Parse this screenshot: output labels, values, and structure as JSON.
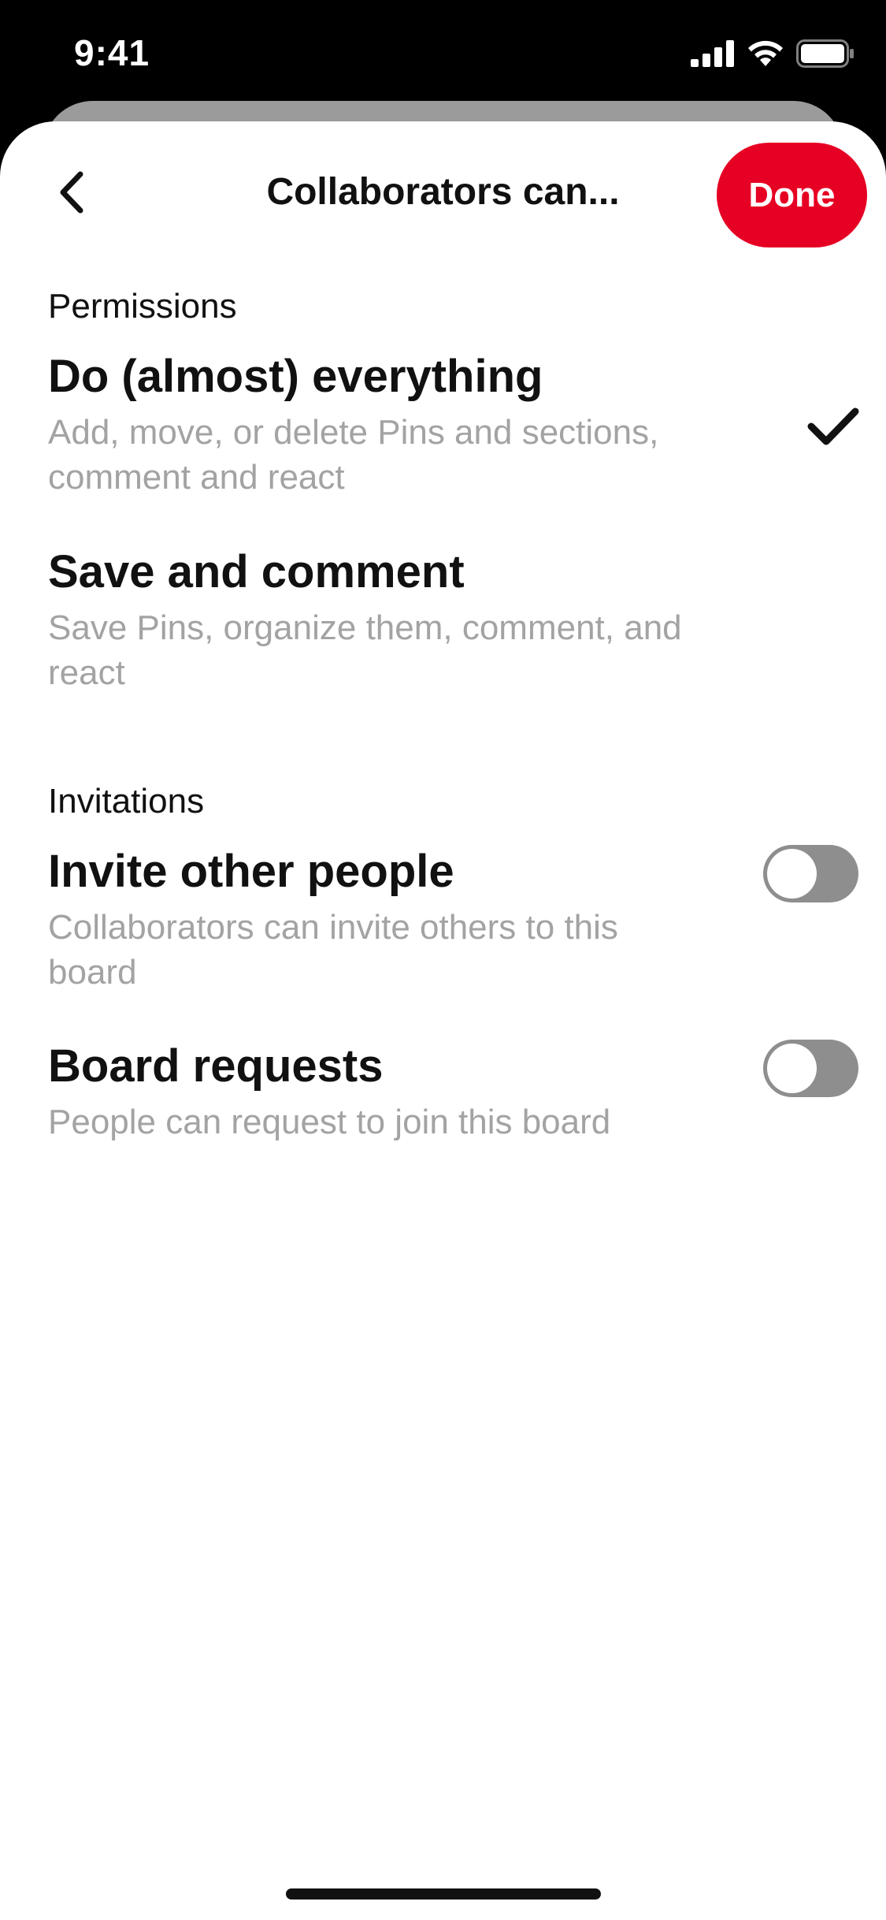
{
  "status_bar": {
    "time": "9:41",
    "icons": [
      "cellular-signal-icon",
      "wifi-icon",
      "battery-icon"
    ]
  },
  "header": {
    "back_icon": "chevron-left-icon",
    "title": "Collaborators can...",
    "done_label": "Done"
  },
  "permissions": {
    "section_label": "Permissions",
    "options": [
      {
        "title": "Do (almost) everything",
        "description": "Add, move, or delete Pins and sections, comment and react",
        "selected": true
      },
      {
        "title": "Save and comment",
        "description": "Save Pins, organize them, comment, and react",
        "selected": false
      }
    ]
  },
  "invitations": {
    "section_label": "Invitations",
    "toggles": [
      {
        "title": "Invite other people",
        "description": "Collaborators can invite others to this board",
        "enabled": false
      },
      {
        "title": "Board requests",
        "description": "People can request to join this board",
        "enabled": false
      }
    ]
  },
  "colors": {
    "accent": "#e60023",
    "text_primary": "#111111",
    "text_secondary": "#a3a3a3",
    "toggle_off": "#8e8e8e"
  }
}
